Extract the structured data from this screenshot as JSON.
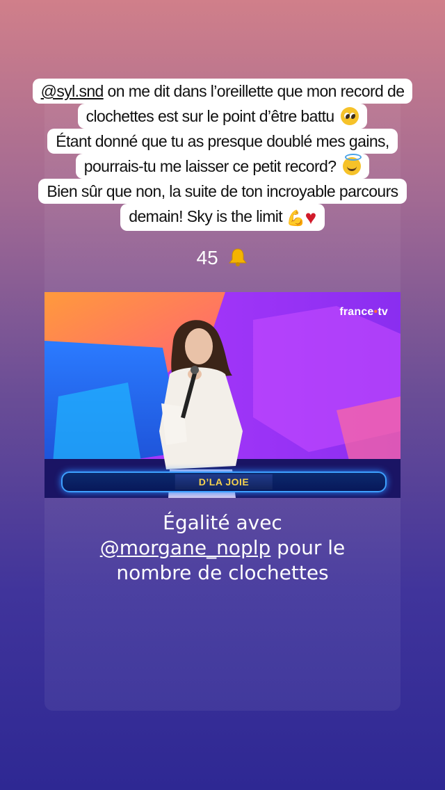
{
  "story": {
    "text_lines": [
      {
        "mention": "@syl.snd",
        "text": " on me dit dans l’oreillette que mon record de"
      },
      {
        "text": "clochettes est sur le point d’être battu"
      },
      {
        "text": "Étant donné que tu as presque doublé mes gains,"
      },
      {
        "text": "pourrais-tu me laisser ce petit record?"
      },
      {
        "text": "Bien sûr que non, la suite de ton incroyable parcours"
      },
      {
        "text": "demain! Sky is the limit"
      }
    ],
    "emojis": [
      "pleading-face-icon",
      "smiling-face-with-halo-icon",
      "flexed-biceps-icon",
      "red-heart-icon"
    ],
    "bell_count": "45",
    "bell_icon": "bell-icon",
    "video": {
      "channel_logo_a": "france",
      "channel_logo_sep": "•",
      "channel_logo_b": "tv",
      "banner_text": "D’LA JOIE"
    },
    "caption": {
      "line1": "Égalité avec",
      "mention": "@morgane_noplp",
      "line2_rest": " pour le",
      "line3": "nombre de clochettes"
    }
  },
  "colors": {
    "bg_top": "#d07f8a",
    "bg_bottom": "#2e2893",
    "text_box": "#ffffff",
    "video_bg": "#7b2bd8",
    "banner_text": "#f4d24e"
  }
}
